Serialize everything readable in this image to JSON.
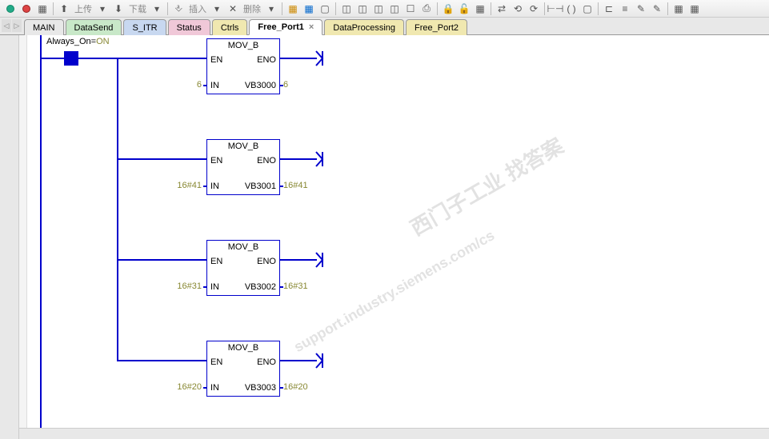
{
  "toolbar": {
    "upload": "上传",
    "download": "下载",
    "insert": "插入",
    "delete": "删除"
  },
  "tabs": [
    {
      "label": "MAIN",
      "cls": "main"
    },
    {
      "label": "DataSend",
      "cls": "green"
    },
    {
      "label": "S_ITR",
      "cls": "blue"
    },
    {
      "label": "Status",
      "cls": "pink"
    },
    {
      "label": "Ctrls",
      "cls": "yellow"
    },
    {
      "label": "Free_Port1",
      "cls": "active",
      "close": true
    },
    {
      "label": "DataProcessing",
      "cls": "yellow"
    },
    {
      "label": "Free_Port2",
      "cls": "yellow"
    }
  ],
  "contact": {
    "name": "Always_On",
    "eq": "=",
    "state": "ON"
  },
  "blocks": [
    {
      "title": "MOV_B",
      "en": "EN",
      "eno": "ENO",
      "in": "IN",
      "out": "VB3000",
      "in_val": "6",
      "out_val": "6"
    },
    {
      "title": "MOV_B",
      "en": "EN",
      "eno": "ENO",
      "in": "IN",
      "out": "VB3001",
      "in_val": "16#41",
      "out_val": "16#41"
    },
    {
      "title": "MOV_B",
      "en": "EN",
      "eno": "ENO",
      "in": "IN",
      "out": "VB3002",
      "in_val": "16#31",
      "out_val": "16#31"
    },
    {
      "title": "MOV_B",
      "en": "EN",
      "eno": "ENO",
      "in": "IN",
      "out": "VB3003",
      "in_val": "16#20",
      "out_val": "16#20"
    }
  ],
  "watermark": {
    "line1": "西门子工业  找答案",
    "line2": "support.industry.siemens.com/cs"
  }
}
